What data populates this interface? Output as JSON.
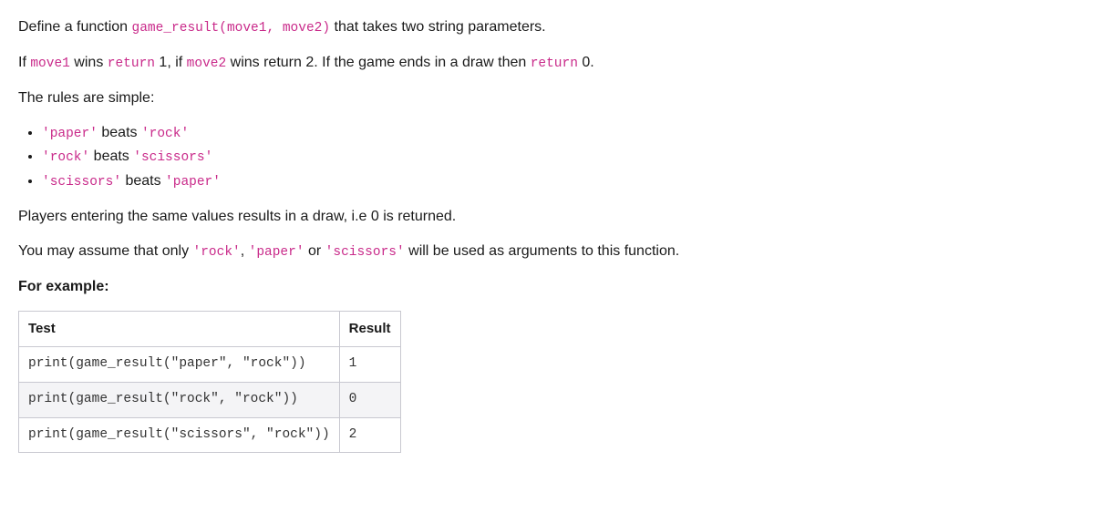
{
  "intro": {
    "p1_prefix": "Define a function ",
    "p1_code": "game_result(move1, move2)",
    "p1_suffix": " that takes two string parameters.",
    "p2_a": "If ",
    "p2_code1": "move1",
    "p2_b": " wins ",
    "p2_code2": "return",
    "p2_c": " 1, if ",
    "p2_code3": "move2",
    "p2_d": " wins return 2. If the game ends in a draw then ",
    "p2_code4": "return",
    "p2_e": " 0.",
    "rules_label": "The rules are simple:"
  },
  "rules": {
    "beats_text": " beats ",
    "r1_a": "'paper'",
    "r1_b": "'rock'",
    "r2_a": "'rock'",
    "r2_b": "'scissors'",
    "r3_a": "'scissors'",
    "r3_b": "'paper'"
  },
  "after": {
    "draw_text": "Players entering the same values results in a draw, i.e 0 is returned.",
    "assume_a": "You may assume that only ",
    "assume_c1": "'rock'",
    "assume_b": ", ",
    "assume_c2": "'paper'",
    "assume_c": " or ",
    "assume_c3": "'scissors'",
    "assume_d": " will be used as arguments to this function.",
    "example_label": "For example:"
  },
  "table": {
    "headers": {
      "test": "Test",
      "result": "Result"
    },
    "rows": [
      {
        "test": "print(game_result(\"paper\", \"rock\"))",
        "result": "1"
      },
      {
        "test": "print(game_result(\"rock\", \"rock\"))",
        "result": "0"
      },
      {
        "test": "print(game_result(\"scissors\", \"rock\"))",
        "result": "2"
      }
    ]
  }
}
